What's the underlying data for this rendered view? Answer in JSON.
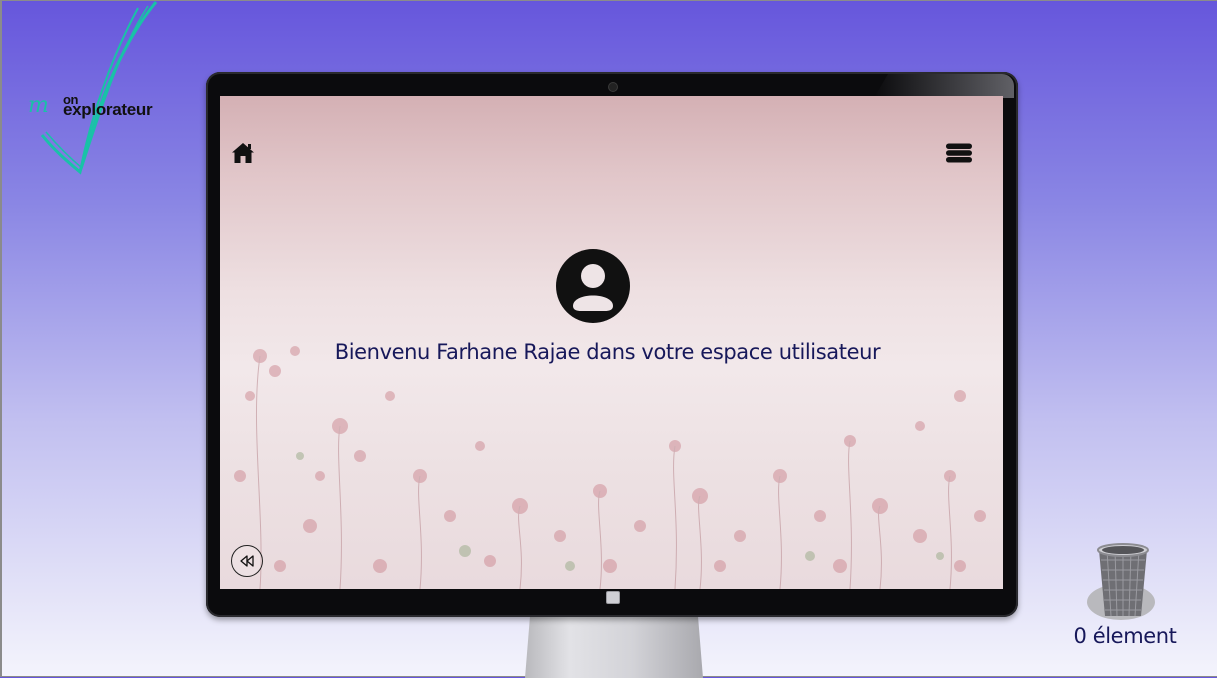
{
  "logo": {
    "line1": "on",
    "line2": "explorateur"
  },
  "screen": {
    "welcome_text": "Bienvenu Farhane Rajae dans votre espace utilisateur"
  },
  "icons": {
    "home": "home-icon",
    "menu": "database-menu-icon",
    "avatar": "user-circle-icon",
    "back": "rewind-icon",
    "trash": "trash-bin-icon"
  },
  "trash": {
    "count_label": "0 élement"
  },
  "colors": {
    "background_top": "#6656dc",
    "background_bottom": "#f4f4fc",
    "logo_teal": "#19c2a7",
    "text_navy": "#17185a"
  }
}
